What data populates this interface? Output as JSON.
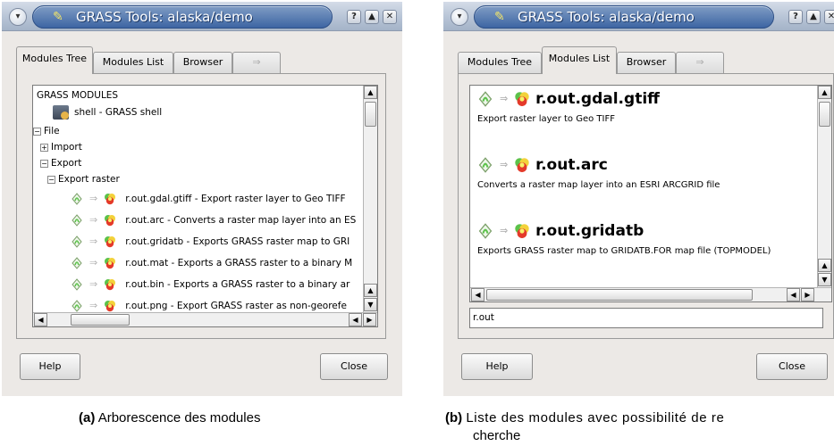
{
  "window_a": {
    "title": "GRASS Tools: alaska/demo",
    "buttons": {
      "help": "?",
      "maximize": "▲",
      "close": "✕",
      "menu": "▾"
    },
    "tabs": [
      "Modules Tree",
      "Modules List",
      "Browser",
      "⇒"
    ],
    "active_tab": 0,
    "tree": {
      "root": "GRASS MODULES",
      "shell": "shell - GRASS shell",
      "file": "File",
      "import": "Import",
      "export": "Export",
      "export_raster": "Export raster",
      "modules": [
        "r.out.gdal.gtiff - Export raster layer to Geo TIFF",
        "r.out.arc - Converts a raster map layer into an ES",
        "r.out.gridatb - Exports GRASS raster map to GRI",
        "r.out.mat - Exports a GRASS raster to a binary M",
        "r.out.bin - Exports a GRASS raster to a binary ar",
        "r.out.png - Export GRASS raster as non-georefe"
      ]
    },
    "help_button": "Help",
    "close_button": "Close"
  },
  "window_b": {
    "title": "GRASS Tools: alaska/demo",
    "buttons": {
      "help": "?",
      "maximize": "▲",
      "close": "✕",
      "menu": "▾"
    },
    "tabs": [
      "Modules Tree",
      "Modules List",
      "Browser",
      "⇒"
    ],
    "active_tab": 1,
    "list": [
      {
        "name": "r.out.gdal.gtiff",
        "description": "Export raster layer to Geo TIFF"
      },
      {
        "name": "r.out.arc",
        "description": "Converts a raster map layer into an ESRI ARCGRID file"
      },
      {
        "name": "r.out.gridatb",
        "description": "Exports GRASS raster map to GRIDATB.FOR map file (TOPMODEL)"
      }
    ],
    "filter_value": "r.out",
    "help_button": "Help",
    "close_button": "Close"
  },
  "captions": {
    "a_label": "(a)",
    "a_text": "Arborescence des modules",
    "b_label": "(b)",
    "b_text_line1": "Liste des modules avec possibilité de re",
    "b_text_line2": "cherche"
  },
  "colors": {
    "titlebar_accent": "#3d65a3",
    "window_bg": "#ece9e6",
    "grass_green": "#5cc24a",
    "raster_red": "#e43a2a"
  }
}
